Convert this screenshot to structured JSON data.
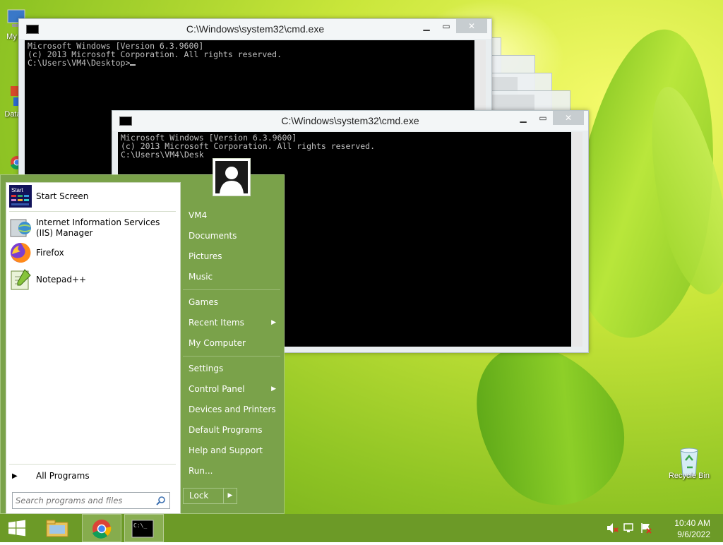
{
  "desktop": {
    "icons": [
      {
        "label": "My C"
      },
      {
        "label": "Data"
      },
      {
        "label": "Recycle Bin"
      }
    ]
  },
  "cmd_windows": [
    {
      "title": "C:\\Windows\\system32\\cmd.exe",
      "lines": [
        "Microsoft Windows [Version 6.3.9600]",
        "(c) 2013 Microsoft Corporation. All rights reserved.",
        "",
        "C:\\Users\\VM4\\Desktop>"
      ]
    },
    {
      "title": "C:\\Windows\\system32\\cmd.exe",
      "lines": [
        "Microsoft Windows [Version 6.3.9600]",
        "(c) 2013 Microsoft Corporation. All rights reserved.",
        "",
        "C:\\Users\\VM4\\Desk"
      ]
    }
  ],
  "start_menu": {
    "left_items": [
      {
        "label": "Start Screen",
        "icon": "start-screen-icon"
      },
      {
        "label": "Internet Information Services (IIS) Manager",
        "icon": "iis-manager-icon"
      },
      {
        "label": "Firefox",
        "icon": "firefox-icon"
      },
      {
        "label": "Notepad++",
        "icon": "notepad-plus-plus-icon"
      }
    ],
    "all_programs": "All Programs",
    "search_placeholder": "Search programs and files",
    "right_items": [
      {
        "label": "VM4"
      },
      {
        "label": "Documents"
      },
      {
        "label": "Pictures"
      },
      {
        "label": "Music"
      },
      {
        "label": "Games"
      },
      {
        "label": "Recent Items"
      },
      {
        "label": "My Computer"
      },
      {
        "label": "Settings"
      },
      {
        "label": "Control Panel"
      },
      {
        "label": "Devices and Printers"
      },
      {
        "label": "Default Programs"
      },
      {
        "label": "Help and Support"
      },
      {
        "label": "Run..."
      }
    ],
    "lock_label": "Lock",
    "start_icon_text": "Start"
  },
  "taskbar": {
    "clock_time": "10:40 AM",
    "clock_date": "9/6/2022"
  }
}
